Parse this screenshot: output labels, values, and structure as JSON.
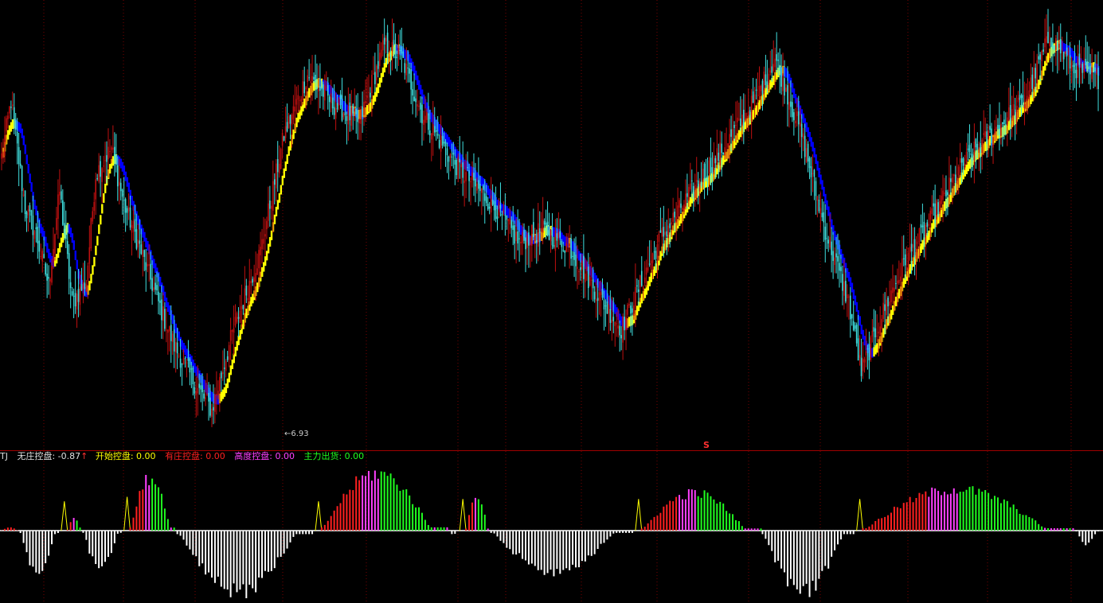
{
  "panel": {
    "indicator_name": "TJ",
    "low_label": "←6.93",
    "marker_s": "S",
    "legend": [
      {
        "label": "无庄控盘: -0.87",
        "color": "#e0e0e0",
        "arrow": "↑"
      },
      {
        "label": "开始控盘: 0.00",
        "color": "#ffff00"
      },
      {
        "label": "有庄控盘: 0.00",
        "color": "#ff2020"
      },
      {
        "label": "高度控盘: 0.00",
        "color": "#ff40ff"
      },
      {
        "label": "主力出货: 0.00",
        "color": "#20ff20"
      }
    ]
  },
  "colors": {
    "up_candle": "#c01010",
    "down_candle": "#40e0e0",
    "ribbon_up": "#ffff00",
    "ribbon_down": "#0000ff",
    "grid": "#7a0000",
    "neg_bar": "#ffffff",
    "red_bar": "#ff2020",
    "green_bar": "#20ff20",
    "magenta_bar": "#ff40ff",
    "start_marker": "#ffff00"
  },
  "chart_data": {
    "type": "candlestick",
    "price_range": [
      6.5,
      16.5
    ],
    "price_anchors": [
      [
        0,
        13.0
      ],
      [
        6,
        14.3
      ],
      [
        15,
        11.8
      ],
      [
        22,
        11.2
      ],
      [
        30,
        10.0
      ],
      [
        37,
        12.2
      ],
      [
        45,
        9.6
      ],
      [
        54,
        10.1
      ],
      [
        60,
        12.6
      ],
      [
        70,
        13.2
      ],
      [
        78,
        11.9
      ],
      [
        88,
        10.9
      ],
      [
        100,
        9.6
      ],
      [
        110,
        8.6
      ],
      [
        125,
        7.6
      ],
      [
        134,
        7.1
      ],
      [
        148,
        9.0
      ],
      [
        165,
        10.8
      ],
      [
        180,
        13.5
      ],
      [
        195,
        14.9
      ],
      [
        212,
        14.2
      ],
      [
        228,
        13.8
      ],
      [
        244,
        15.6
      ],
      [
        255,
        15.3
      ],
      [
        268,
        14.0
      ],
      [
        290,
        12.8
      ],
      [
        315,
        11.8
      ],
      [
        330,
        11.0
      ],
      [
        345,
        11.3
      ],
      [
        362,
        10.9
      ],
      [
        380,
        9.8
      ],
      [
        395,
        9.0
      ],
      [
        420,
        11.1
      ],
      [
        440,
        12.2
      ],
      [
        460,
        13.2
      ],
      [
        480,
        14.3
      ],
      [
        493,
        15.3
      ],
      [
        510,
        13.5
      ],
      [
        525,
        11.3
      ],
      [
        540,
        9.6
      ],
      [
        548,
        8.0
      ],
      [
        562,
        9.4
      ],
      [
        575,
        10.5
      ],
      [
        592,
        11.5
      ],
      [
        612,
        12.8
      ],
      [
        630,
        13.5
      ],
      [
        652,
        14.3
      ],
      [
        668,
        15.8
      ],
      [
        683,
        15.1
      ],
      [
        700,
        14.8
      ]
    ],
    "num_bars": 700,
    "oscillator": {
      "range": [
        -1.6,
        1.5
      ],
      "segments": [
        {
          "from": 0,
          "to": 12,
          "peak": 0.08,
          "kind": "pos_red"
        },
        {
          "from": 12,
          "to": 38,
          "peak": -1.1,
          "kind": "neg"
        },
        {
          "from": 38,
          "to": 42,
          "peak": 0.65,
          "kind": "start"
        },
        {
          "from": 42,
          "to": 52,
          "peak": 0.3,
          "kind": "pos_mix"
        },
        {
          "from": 52,
          "to": 78,
          "peak": -1.0,
          "kind": "neg"
        },
        {
          "from": 78,
          "to": 82,
          "peak": 0.75,
          "kind": "start"
        },
        {
          "from": 82,
          "to": 112,
          "peak": 1.35,
          "kind": "pos_mix"
        },
        {
          "from": 112,
          "to": 200,
          "peak": -1.6,
          "kind": "neg"
        },
        {
          "from": 200,
          "to": 204,
          "peak": 0.65,
          "kind": "start"
        },
        {
          "from": 204,
          "to": 285,
          "peak": 1.45,
          "kind": "pos_mix"
        },
        {
          "from": 285,
          "to": 292,
          "peak": -0.1,
          "kind": "neg"
        },
        {
          "from": 292,
          "to": 296,
          "peak": 0.7,
          "kind": "start"
        },
        {
          "from": 296,
          "to": 312,
          "peak": 0.9,
          "kind": "pos_mix"
        },
        {
          "from": 312,
          "to": 404,
          "peak": -1.05,
          "kind": "neg"
        },
        {
          "from": 404,
          "to": 408,
          "peak": 0.7,
          "kind": "start"
        },
        {
          "from": 408,
          "to": 485,
          "peak": 0.95,
          "kind": "pos_mix"
        },
        {
          "from": 485,
          "to": 545,
          "peak": -1.6,
          "kind": "neg"
        },
        {
          "from": 545,
          "to": 549,
          "peak": 0.7,
          "kind": "start"
        },
        {
          "from": 549,
          "to": 685,
          "peak": 1.05,
          "kind": "pos_mix"
        },
        {
          "from": 685,
          "to": 700,
          "peak": -0.35,
          "kind": "neg"
        }
      ]
    }
  }
}
